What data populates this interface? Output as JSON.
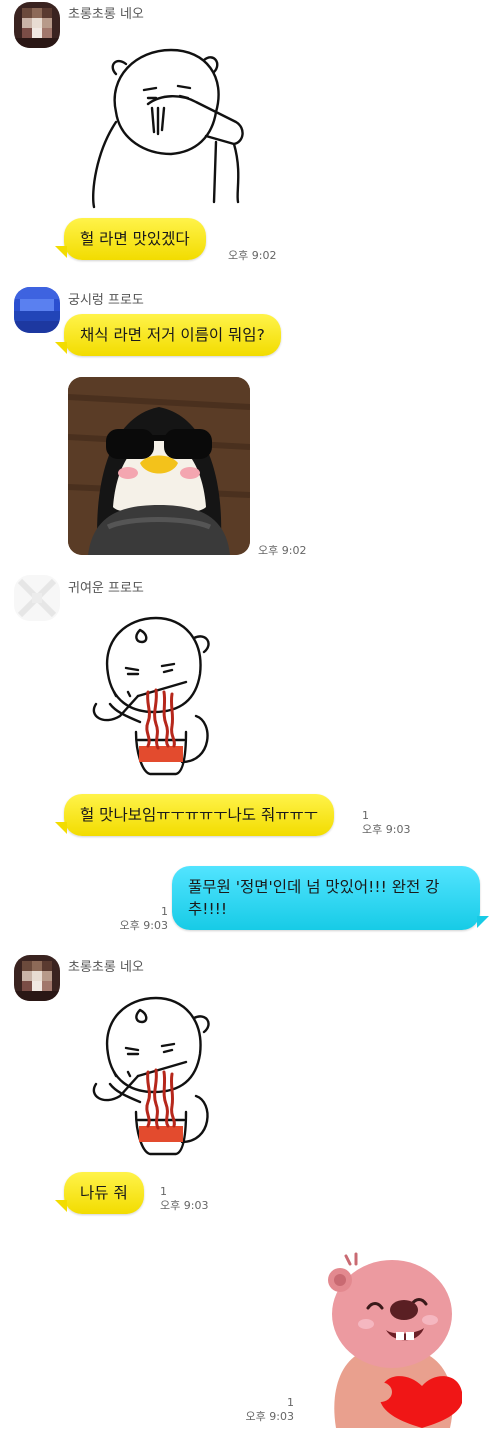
{
  "messages": [
    {
      "sender": "초롱초롱 네오",
      "text": "헐 라면 맛있겠다",
      "time": "오후 9:02",
      "sticker": "noodle-slurp-sticker"
    },
    {
      "sender": "궁시렁 프로도",
      "text": "채식 라면 저거 이름이 뭐임?",
      "time": "오후 9:02",
      "photo": "penguin-sunglasses-photo"
    },
    {
      "sender": "귀여운 프로도",
      "text": "헐 맛나보임ㅠㅜㅠㅠㅜ나도 줘ㅠㅠㅜ",
      "time": "오후 9:03",
      "unread": "1",
      "sticker": "ramen-eating-sticker"
    },
    {
      "sender": "me",
      "text": "풀무원 '정면'인데 넘 맛있어!!! 완전 강추!!!!",
      "time": "오후 9:03",
      "unread": "1"
    },
    {
      "sender": "초롱초롱 네오",
      "text": "나듀 줘",
      "time": "오후 9:03",
      "unread": "1",
      "sticker": "ramen-eating-sticker"
    },
    {
      "sender": "me",
      "time": "오후 9:03",
      "unread": "1",
      "sticker": "beaver-heart-sticker"
    }
  ],
  "colors": {
    "incoming_bubble": "#f5e100",
    "outgoing_bubble": "#2fd6f0",
    "background": "#ffffff"
  }
}
